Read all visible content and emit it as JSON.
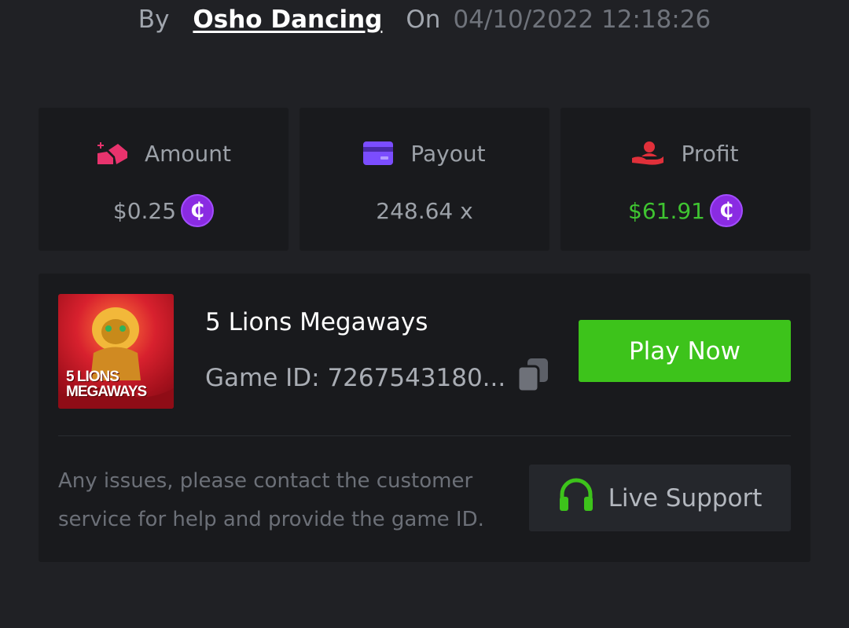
{
  "header": {
    "by_label": "By",
    "author": "Osho Dancing",
    "on_label": "On",
    "datetime": "04/10/2022 12:18:26"
  },
  "stats": {
    "amount": {
      "label": "Amount",
      "value": "$0.25",
      "icon": "bet-chips-icon",
      "icon_color": "#e8336d"
    },
    "payout": {
      "label": "Payout",
      "value": "248.64 x",
      "icon": "credit-card-icon",
      "icon_color": "#7b4dff"
    },
    "profit": {
      "label": "Profit",
      "value": "$61.91",
      "icon": "hand-user-icon",
      "icon_color": "#e0303a",
      "value_color": "#3fc431"
    },
    "coin_symbol": "₵",
    "coin_color": "#8a2be2"
  },
  "game": {
    "thumbnail_text_line1": "5 LIONS",
    "thumbnail_text_line2": "MEGAWAYS",
    "title": "5 Lions Megaways",
    "game_id_label": "Game ID: 7267543180...",
    "play_button": "Play Now",
    "play_button_color": "#3dc31b"
  },
  "support": {
    "help_text": "Any issues, please contact the customer service for help and provide the game ID.",
    "button_label": "Live Support",
    "icon": "headset-icon",
    "icon_color": "#3dc31b"
  }
}
